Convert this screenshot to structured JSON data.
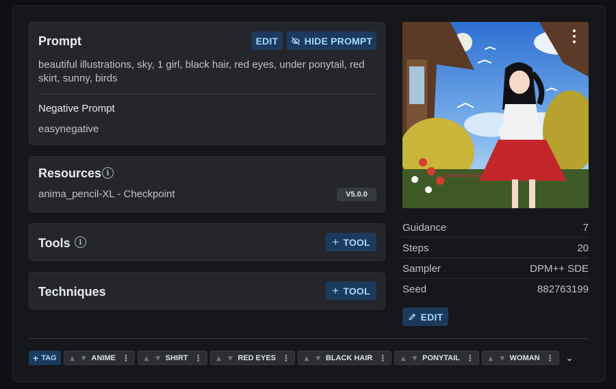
{
  "prompt": {
    "title": "Prompt",
    "edit_label": "EDIT",
    "hide_label": "HIDE PROMPT",
    "text": "beautiful illustrations, sky, 1 girl, black hair, red eyes, under ponytail, red skirt, sunny, birds",
    "negative_title": "Negative Prompt",
    "negative_text": "easynegative"
  },
  "resources": {
    "title": "Resources",
    "info_icon": "info-icon",
    "item_name": "anima_pencil-XL - Checkpoint",
    "item_version": "V5.0.0"
  },
  "tools": {
    "title": "Tools",
    "info_icon": "info-icon",
    "add_label": "TOOL"
  },
  "techniques": {
    "title": "Techniques",
    "add_label": "TOOL"
  },
  "params": [
    {
      "label": "Guidance",
      "value": "7"
    },
    {
      "label": "Steps",
      "value": "20"
    },
    {
      "label": "Sampler",
      "value": "DPM++ SDE"
    },
    {
      "label": "Seed",
      "value": "882763199"
    }
  ],
  "params_edit_label": "EDIT",
  "tags": {
    "add_label": "TAG",
    "items": [
      "ANIME",
      "SHIRT",
      "RED EYES",
      "BLACK HAIR",
      "PONYTAIL",
      "WOMAN"
    ]
  },
  "colors": {
    "accent": "#a5d8ff",
    "accent_bg": "#1c3a5c",
    "card_bg": "#25262b",
    "page_bg": "#16171a"
  }
}
